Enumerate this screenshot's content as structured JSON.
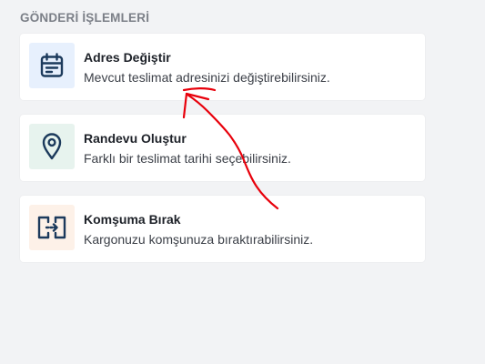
{
  "section": {
    "title": "GÖNDERİ İŞLEMLERİ"
  },
  "actions": [
    {
      "title": "Adres Değiştir",
      "description": "Mevcut teslimat adresinizi değiştirebilirsiniz.",
      "icon": "calendar-icon",
      "icon_bg": "#e7f0fd"
    },
    {
      "title": "Randevu Oluştur",
      "description": "Farklı bir teslimat tarihi seçebilirsiniz.",
      "icon": "location-pin-icon",
      "icon_bg": "#e7f3ee"
    },
    {
      "title": "Komşuma Bırak",
      "description": "Kargonuzu komşunuza bıraktırabilirsiniz.",
      "icon": "transfer-icon",
      "icon_bg": "#fdf1e8"
    }
  ],
  "colors": {
    "page_bg": "#f2f3f5",
    "card_bg": "#ffffff",
    "icon_stroke": "#1c3a5c",
    "annotation_red": "#e8000b"
  }
}
